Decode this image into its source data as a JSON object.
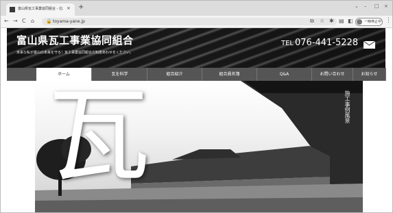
{
  "browser": {
    "tab_title": "富山県瓦工事業協同組合 - 北木",
    "tab_close": "×",
    "new_tab": "+",
    "window_controls": [
      "⌄",
      "–",
      "□",
      "×"
    ],
    "nav_icons": [
      "←",
      "→",
      "C",
      "⌂"
    ],
    "url": "toyama-yane.jp",
    "toolbar_icons": [
      "⧉",
      "☆",
      "✱",
      "▤",
      "◧"
    ],
    "profile_label": "一時停止中",
    "menu_icon": "⋮"
  },
  "site": {
    "title": "富山県瓦工事業協同組合",
    "tagline": "未来な私が富山の未来を守る！瓦工事業協同組合の知恵あわせをください。",
    "phone_icon": "TEL",
    "phone": "076-441-5228",
    "mail_icon": "envelope-icon"
  },
  "nav": {
    "items": [
      "ホーム",
      "瓦を科学",
      "組合紹介",
      "組合員名簿",
      "Q&A",
      "お問い合わせ",
      "お知らせ"
    ],
    "active_index": 0
  },
  "hero": {
    "kanji": "瓦",
    "vertical_text": "施工事例風景"
  },
  "colors": {
    "nav_bg": "#555555",
    "header_bg": "#1a1a1a",
    "accent_white": "#ffffff"
  }
}
